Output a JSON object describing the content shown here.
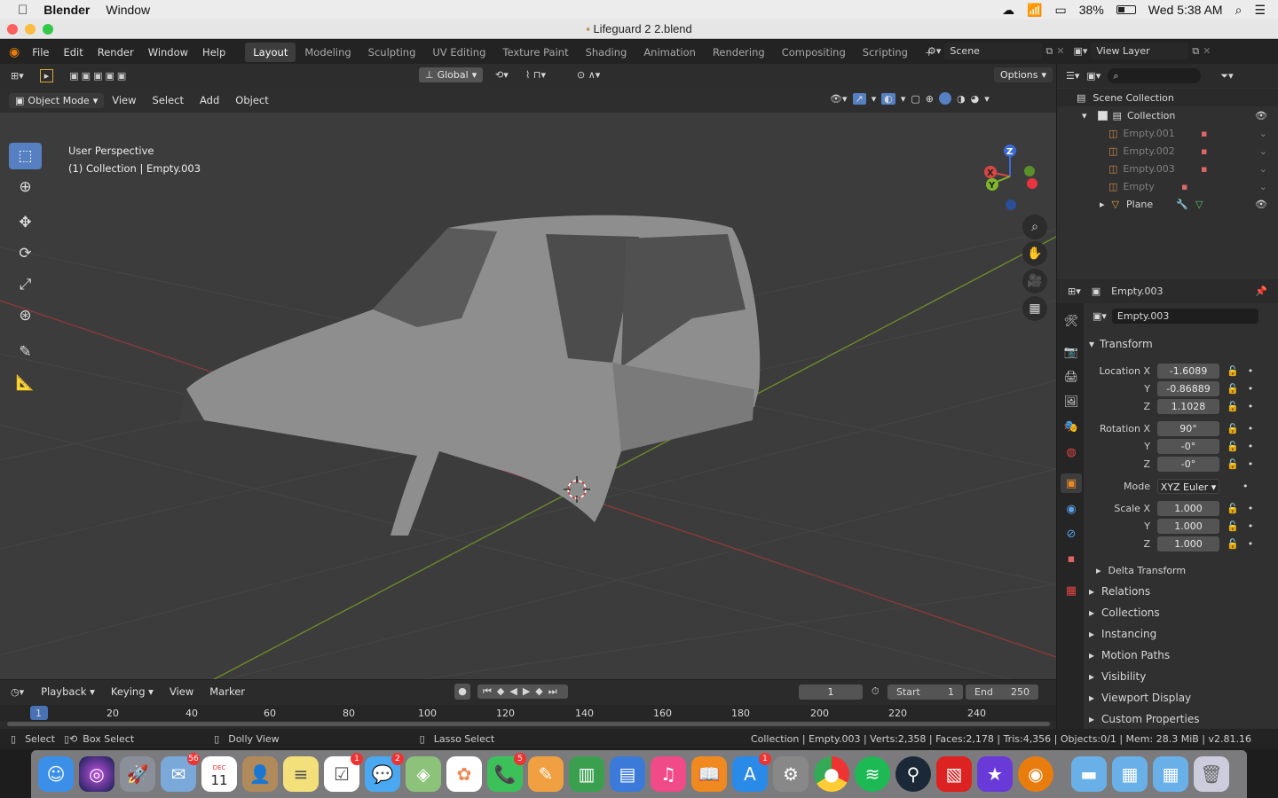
{
  "mac_menubar": {
    "app": "Blender",
    "window": "Window",
    "battery": "38%",
    "clock": "Wed 5:38 AM"
  },
  "title": "Lifeguard 2 2.blend",
  "top_menus": [
    "File",
    "Edit",
    "Render",
    "Window",
    "Help"
  ],
  "workspaces": [
    "Layout",
    "Modeling",
    "Sculpting",
    "UV Editing",
    "Texture Paint",
    "Shading",
    "Animation",
    "Rendering",
    "Compositing",
    "Scripting"
  ],
  "scene": "Scene",
  "view_layer": "View Layer",
  "viewport": {
    "mode": "Object Mode",
    "menus": [
      "View",
      "Select",
      "Add",
      "Object"
    ],
    "orientation": "Global",
    "options": "Options",
    "overlay_line1": "User Perspective",
    "overlay_line2": "(1) Collection | Empty.003",
    "gizmo": {
      "x": "X",
      "y": "Y",
      "z": "Z"
    }
  },
  "outliner": {
    "root": "Scene Collection",
    "collection": "Collection",
    "items": [
      "Empty.001",
      "Empty.002",
      "Empty.003",
      "Empty",
      "Plane"
    ]
  },
  "properties": {
    "object_header": "Empty.003",
    "object_name": "Empty.003",
    "transform_label": "Transform",
    "location": {
      "label": "Location X",
      "x": "-1.6089",
      "y": "-0.86889",
      "z": "1.1028"
    },
    "rotation": {
      "label": "Rotation X",
      "x": "90°",
      "y": "-0°",
      "z": "-0°"
    },
    "mode": {
      "label": "Mode",
      "value": "XYZ Euler"
    },
    "scale": {
      "label": "Scale X",
      "x": "1.000",
      "y": "1.000",
      "z": "1.000"
    },
    "axis_y": "Y",
    "axis_z": "Z",
    "delta": "Delta Transform",
    "sections": [
      "Relations",
      "Collections",
      "Instancing",
      "Motion Paths",
      "Visibility",
      "Viewport Display",
      "Custom Properties"
    ]
  },
  "timeline": {
    "menus": [
      "Playback",
      "Keying",
      "View",
      "Marker"
    ],
    "current_frame": "1",
    "start_label": "Start",
    "start": "1",
    "end_label": "End",
    "end": "250",
    "ticks": [
      "1",
      "20",
      "40",
      "60",
      "80",
      "100",
      "120",
      "140",
      "160",
      "180",
      "200",
      "220",
      "240"
    ]
  },
  "status": {
    "select": "Select",
    "box_select": "Box Select",
    "dolly": "Dolly View",
    "lasso": "Lasso Select",
    "info": "Collection | Empty.003 | Verts:2,358 | Faces:2,178 | Tris:4,356 | Objects:0/1 | Mem: 28.3 MiB | v2.81.16"
  },
  "dock": {
    "badges": {
      "mail": "56",
      "calendar_month": "DEC",
      "calendar_day": "11",
      "reminders": "1",
      "messages": "2",
      "facetime": "5",
      "appstore": "1"
    }
  }
}
